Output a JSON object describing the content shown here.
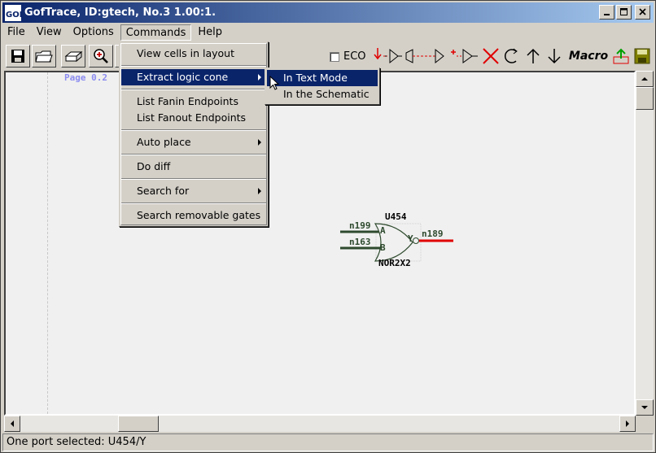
{
  "window": {
    "title": "GofTrace, ID:gtech, No.3 1.00:1.",
    "app_icon_text": "GOF"
  },
  "menubar": {
    "items": [
      "File",
      "View",
      "Options",
      "Commands",
      "Help"
    ]
  },
  "toolbar": {
    "eco_label": "ECO",
    "macro_label": "Macro"
  },
  "canvas": {
    "page_label": "Page 0.2"
  },
  "schematic": {
    "instance": "U454",
    "cell": "NOR2X2",
    "inputs": [
      {
        "net": "n199",
        "pin": "A"
      },
      {
        "net": "n163",
        "pin": "B"
      }
    ],
    "output": {
      "net": "n189",
      "pin": "Y"
    }
  },
  "commands_menu": {
    "items": [
      {
        "label": "View cells in layout",
        "submenu": false
      },
      {
        "label": "Extract logic cone",
        "submenu": true
      },
      {
        "label": "List Fanin Endpoints",
        "submenu": false
      },
      {
        "label": "List Fanout Endpoints",
        "submenu": false
      },
      {
        "label": "Auto place",
        "submenu": true
      },
      {
        "label": "Do diff",
        "submenu": false
      },
      {
        "label": "Search for",
        "submenu": true
      },
      {
        "label": "Search removable gates",
        "submenu": false
      }
    ]
  },
  "extract_submenu": {
    "items": [
      "In Text Mode",
      "In the Schematic"
    ]
  },
  "status": {
    "text": "One port selected: U454/Y"
  },
  "colors": {
    "title_start": "#0a246a",
    "title_end": "#a6caf0",
    "highlight": "#0a246a",
    "net_wire": "#2e4a2e",
    "selected_wire": "#e00000",
    "page_label": "#8c8cf0"
  }
}
